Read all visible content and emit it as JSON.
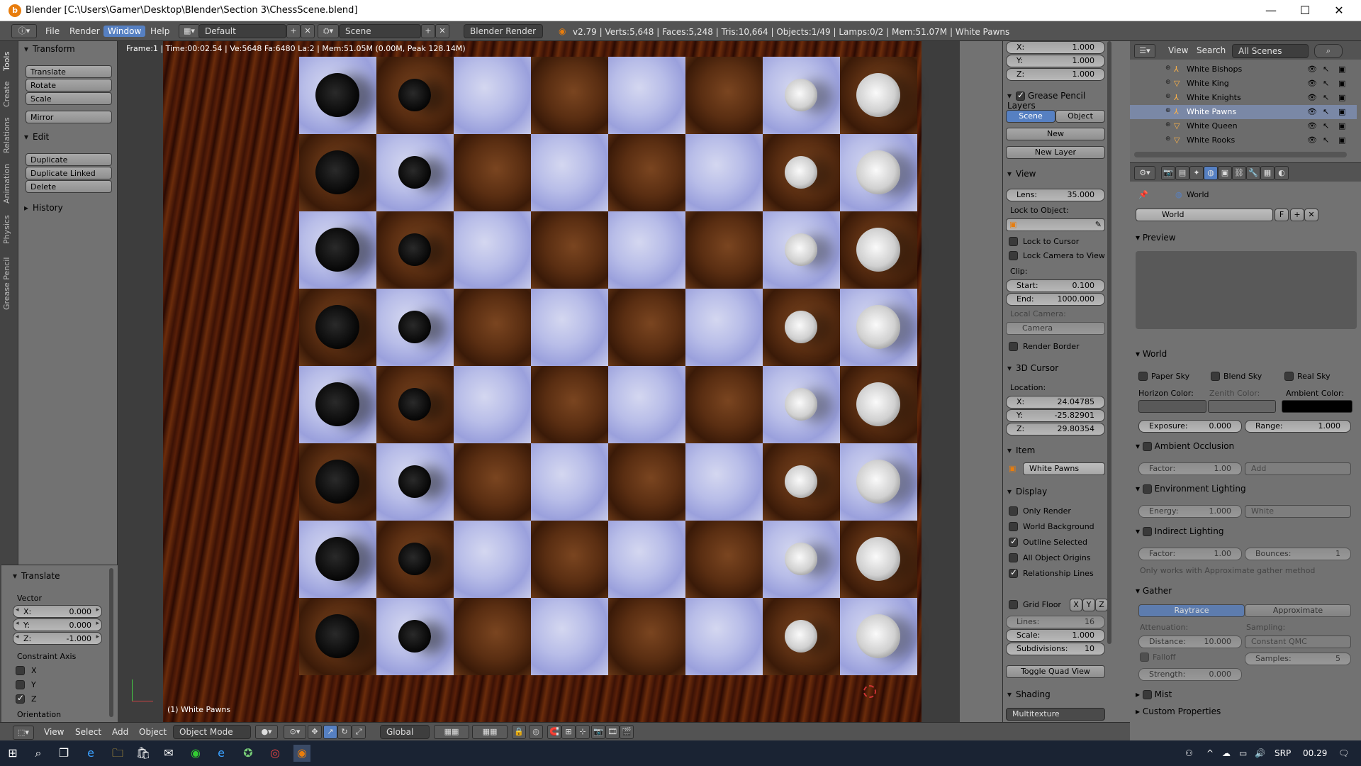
{
  "window": {
    "title": "Blender [C:\\Users\\Gamer\\Desktop\\Blender\\Section 3\\ChessScene.blend]",
    "minimize": "—",
    "maximize": "☐",
    "close": "✕"
  },
  "info_bar": {
    "menus": [
      "File",
      "Render",
      "Window",
      "Help"
    ],
    "active_menu": "Window",
    "layout": "Default",
    "scene": "Scene",
    "engine": "Blender Render",
    "stats": "v2.79 | Verts:5,648 | Faces:5,248 | Tris:10,664 | Objects:1/49 | Lamps:0/2 | Mem:51.07M | White Pawns"
  },
  "left_tabs": [
    "Tools",
    "Create",
    "Relations",
    "Animation",
    "Physics",
    "Grease Pencil"
  ],
  "tool_shelf": {
    "transform_header": "Transform",
    "transform_buttons": [
      "Translate",
      "Rotate",
      "Scale"
    ],
    "mirror": "Mirror",
    "edit_header": "Edit",
    "edit_buttons": [
      "Duplicate",
      "Duplicate Linked",
      "Delete"
    ],
    "history_header": "History"
  },
  "operator_panel": {
    "header": "Translate",
    "vector_label": "Vector",
    "x_label": "X:",
    "x_value": "0.000",
    "y_label": "Y:",
    "y_value": "0.000",
    "z_label": "Z:",
    "z_value": "-1.000",
    "constraint_label": "Constraint Axis",
    "axes": [
      {
        "name": "X",
        "checked": false
      },
      {
        "name": "Y",
        "checked": false
      },
      {
        "name": "Z",
        "checked": true
      }
    ],
    "orientation_label": "Orientation"
  },
  "viewport": {
    "info": "Frame:1 | Time:00:02.54 | Ve:5648 Fa:6480 La:2 | Mem:51.05M (0.00M, Peak 128.14M)",
    "object_label": "(1) White Pawns",
    "board_rows": 8,
    "black_big_col": 0,
    "black_small_col": 1,
    "white_small_col": 6,
    "white_big_col": 7
  },
  "n_panel": {
    "scale_x_label": "X:",
    "scale_x": "1.000",
    "scale_y_label": "Y:",
    "scale_y": "1.000",
    "scale_z_label": "Z:",
    "scale_z": "1.000",
    "grease_header": "Grease Pencil Layers",
    "scene_tab": "Scene",
    "object_tab": "Object",
    "new_btn": "New",
    "new_layer_btn": "New Layer",
    "view_header": "View",
    "lens_label": "Lens:",
    "lens_value": "35.000",
    "lock_to_object": "Lock to Object:",
    "lock_to_cursor": "Lock to Cursor",
    "lock_camera": "Lock Camera to View",
    "clip_label": "Clip:",
    "clip_start_label": "Start:",
    "clip_start": "0.100",
    "clip_end_label": "End:",
    "clip_end": "1000.000",
    "local_camera": "Local Camera:",
    "camera_value": "Camera",
    "render_border": "Render Border",
    "cursor_header": "3D Cursor",
    "location_label": "Location:",
    "cursor_x_label": "X:",
    "cursor_x": "24.04785",
    "cursor_y_label": "Y:",
    "cursor_y": "-25.82901",
    "cursor_z_label": "Z:",
    "cursor_z": "29.80354",
    "item_header": "Item",
    "item_name": "White Pawns",
    "display_header": "Display",
    "display_options": [
      {
        "label": "Only Render",
        "checked": false
      },
      {
        "label": "World Background",
        "checked": false
      },
      {
        "label": "Outline Selected",
        "checked": true
      },
      {
        "label": "All Object Origins",
        "checked": false
      },
      {
        "label": "Relationship Lines",
        "checked": true
      }
    ],
    "grid_floor": "Grid Floor",
    "grid_axes": [
      "X",
      "Y",
      "Z"
    ],
    "lines_label": "Lines:",
    "lines_value": "16",
    "scale_label": "Scale:",
    "scale_value": "1.000",
    "subdiv_label": "Subdivisions:",
    "subdiv_value": "10",
    "toggle_quad": "Toggle Quad View",
    "shading_header": "Shading",
    "shading_value": "Multitexture"
  },
  "outliner": {
    "view": "View",
    "search": "Search",
    "scenes": "All Scenes",
    "items": [
      "White Bishops",
      "White King",
      "White Knights",
      "White Pawns",
      "White Queen",
      "White Rooks"
    ],
    "selected": "White Pawns"
  },
  "properties": {
    "breadcrumb": "World",
    "world_name": "World",
    "fake_user": "F",
    "preview_header": "Preview",
    "world_header": "World",
    "sky_options": [
      "Paper Sky",
      "Blend Sky",
      "Real Sky"
    ],
    "horizon_label": "Horizon Color:",
    "zenith_label": "Zenith Color:",
    "ambient_label": "Ambient Color:",
    "exposure_label": "Exposure:",
    "exposure_value": "0.000",
    "range_label": "Range:",
    "range_value": "1.000",
    "ao_header": "Ambient Occlusion",
    "ao_factor_label": "Factor:",
    "ao_factor": "1.00",
    "ao_mode": "Add",
    "env_header": "Environment Lighting",
    "energy_label": "Energy:",
    "energy_value": "1.000",
    "env_color": "White",
    "indirect_header": "Indirect Lighting",
    "ind_factor_label": "Factor:",
    "ind_factor": "1.00",
    "bounces_label": "Bounces:",
    "bounces_value": "1",
    "indirect_note": "Only works with Approximate gather method",
    "gather_header": "Gather",
    "raytrace": "Raytrace",
    "approximate": "Approximate",
    "attenuation_label": "Attenuation:",
    "sampling_label": "Sampling:",
    "distance_label": "Distance:",
    "distance_value": "10.000",
    "sampling_value": "Constant QMC",
    "falloff": "Falloff",
    "samples_label": "Samples:",
    "samples_value": "5",
    "strength_label": "Strength:",
    "strength_value": "0.000",
    "mist_header": "Mist",
    "custom_header": "Custom Properties"
  },
  "viewport_header": {
    "menus": [
      "View",
      "Select",
      "Add",
      "Object"
    ],
    "mode": "Object Mode",
    "orientation": "Global"
  },
  "taskbar": {
    "lang": "SRP",
    "time": "00.29"
  }
}
